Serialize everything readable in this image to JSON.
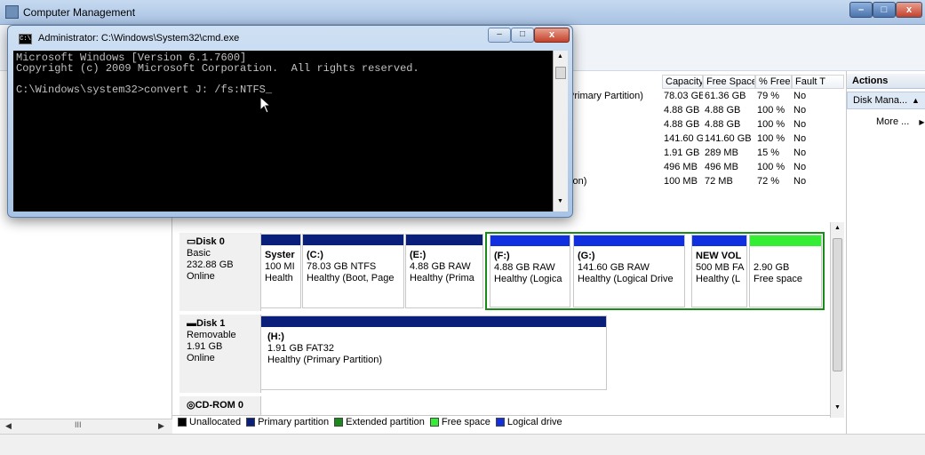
{
  "main_window": {
    "title": "Computer Management",
    "buttons": {
      "minimize": "–",
      "maximize": "□",
      "close": "x"
    }
  },
  "volume_table": {
    "columns": [
      "Capacity",
      "Free Space",
      "% Free",
      "Fault T"
    ],
    "rows": [
      {
        "layout": "Primary Partition)",
        "capacity": "78.03 GB",
        "free": "61.36 GB",
        "pct": "79 %",
        "fault": "No"
      },
      {
        "layout": "",
        "capacity": "4.88 GB",
        "free": "4.88 GB",
        "pct": "100 %",
        "fault": "No"
      },
      {
        "layout": "",
        "capacity": "4.88 GB",
        "free": "4.88 GB",
        "pct": "100 %",
        "fault": "No"
      },
      {
        "layout": "",
        "capacity": "141.60 GB",
        "free": "141.60 GB",
        "pct": "100 %",
        "fault": "No"
      },
      {
        "layout": "",
        "capacity": "1.91 GB",
        "free": "289 MB",
        "pct": "15 %",
        "fault": "No"
      },
      {
        "layout": "",
        "capacity": "496 MB",
        "free": "496 MB",
        "pct": "100 %",
        "fault": "No"
      },
      {
        "layout": "tion)",
        "capacity": "100 MB",
        "free": "72 MB",
        "pct": "72 %",
        "fault": "No"
      }
    ]
  },
  "actions": {
    "header": "Actions",
    "section": "Disk Mana...",
    "section_arrow": "▲",
    "more": "More ...",
    "more_arrow": "▶"
  },
  "disks": [
    {
      "name": "Disk 0",
      "type": "Basic",
      "size": "232.88 GB",
      "status": "Online"
    },
    {
      "name": "Disk 1",
      "type": "Removable",
      "size": "1.91 GB",
      "status": "Online"
    },
    {
      "name": "CD-ROM 0"
    }
  ],
  "partitions": {
    "system": {
      "label": "Syster",
      "size": "100 MI",
      "status": "Health"
    },
    "c": {
      "label": "(C:)",
      "size": "78.03 GB NTFS",
      "status": "Healthy (Boot, Page"
    },
    "e": {
      "label": "(E:)",
      "size": "4.88 GB RAW",
      "status": "Healthy (Prima"
    },
    "f": {
      "label": "(F:)",
      "size": "4.88 GB RAW",
      "status": "Healthy (Logica"
    },
    "g": {
      "label": "(G:)",
      "size": "141.60 GB RAW",
      "status": "Healthy (Logical Drive"
    },
    "newvol": {
      "label": "NEW VOL",
      "size": "500 MB FA",
      "status": "Healthy (L"
    },
    "free": {
      "size": "2.90 GB",
      "status": "Free space"
    },
    "h": {
      "label": "(H:)",
      "size": "1.91 GB FAT32",
      "status": "Healthy (Primary Partition)"
    }
  },
  "legend": [
    {
      "label": "Unallocated",
      "color": "#000000"
    },
    {
      "label": "Primary partition",
      "color": "#0a1f7a"
    },
    {
      "label": "Extended partition",
      "color": "#1a8a1a"
    },
    {
      "label": "Free space",
      "color": "#33ee33"
    },
    {
      "label": "Logical drive",
      "color": "#1030e0"
    }
  ],
  "colors": {
    "primary": "#0a1f7a",
    "logical": "#1030e0",
    "extended": "#1a8a1a",
    "free": "#33ee33"
  },
  "cmd": {
    "title": "Administrator: C:\\Windows\\System32\\cmd.exe",
    "icon_text": "C:\\",
    "buttons": {
      "minimize": "–",
      "maximize": "□",
      "close": "x"
    },
    "console_text": "Microsoft Windows [Version 6.1.7600]\nCopyright (c) 2009 Microsoft Corporation.  All rights reserved.\n\nC:\\Windows\\system32>convert J: /fs:NTFS_"
  },
  "hscroll": {
    "left": "◀",
    "right": "▶",
    "grip": "III"
  }
}
